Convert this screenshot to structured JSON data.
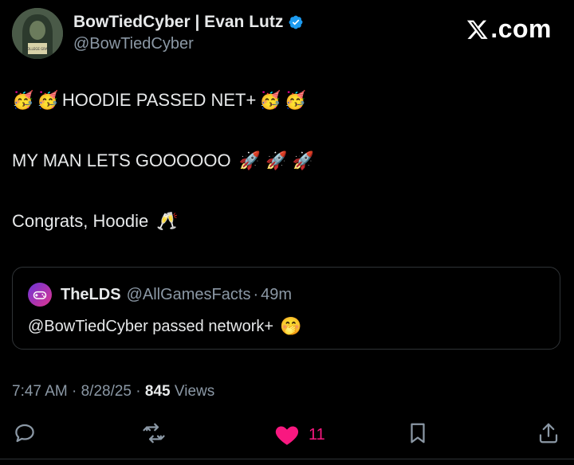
{
  "author": {
    "name": "BowTiedCyber | Evan Lutz",
    "handle": "@BowTiedCyber",
    "verified": true,
    "avatar_icon": "hooded-figure-avatar",
    "avatar_caption": "COLLEGE GRAD"
  },
  "brand": {
    "label": ".com",
    "logo_icon": "x-logo-icon"
  },
  "tweet": {
    "lines": [
      {
        "text": "HOODIE PASSED NET+",
        "emoji_before": [
          "🥳",
          "🥳"
        ],
        "emoji_after": [
          "🥳",
          "🥳"
        ]
      },
      {
        "text": "MY MAN LETS GOOOOOO",
        "emoji_after": [
          "🚀",
          "🚀",
          "🚀"
        ]
      },
      {
        "text": "Congrats, Hoodie",
        "emoji_after": [
          "🥂"
        ]
      }
    ]
  },
  "quote": {
    "name": "TheLDS",
    "handle": "@AllGamesFacts",
    "separator": "·",
    "age": "49m",
    "text": "@BowTiedCyber passed network+",
    "emoji": "🤭",
    "avatar_icon": "game-controller-icon"
  },
  "meta": {
    "time": "7:47 AM",
    "date": "8/28/25",
    "views_count": "845",
    "views_label": "Views",
    "separator": "·"
  },
  "actions": {
    "reply_icon": "reply-icon",
    "retweet_icon": "retweet-icon",
    "like_icon": "heart-icon",
    "like_count": "11",
    "bookmark_icon": "bookmark-icon",
    "share_icon": "share-icon",
    "like_color": "#f91880"
  },
  "colors": {
    "background": "#000000",
    "text": "#e7e9ea",
    "muted": "#8b98a5",
    "border": "#2f3336",
    "verified": "#1d9bf0"
  }
}
